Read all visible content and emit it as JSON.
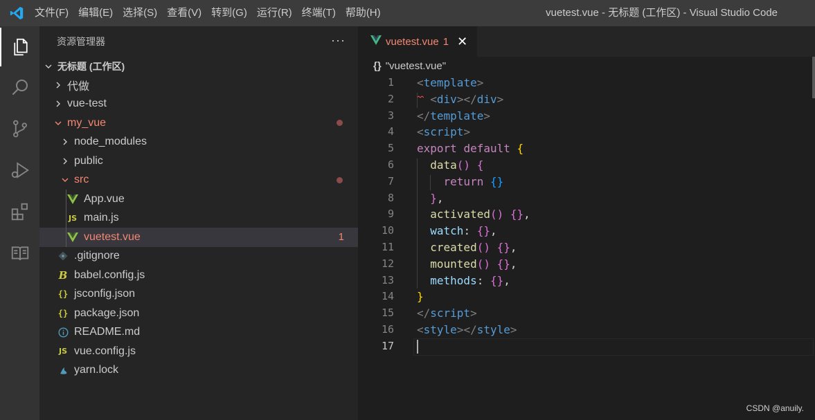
{
  "titlebar": {
    "menu": [
      "文件(F)",
      "编辑(E)",
      "选择(S)",
      "查看(V)",
      "转到(G)",
      "运行(R)",
      "终端(T)",
      "帮助(H)"
    ],
    "window_title": "vuetest.vue - 无标题 (工作区) - Visual Studio Code"
  },
  "activitybar": {
    "icons": [
      "explorer-icon",
      "search-icon",
      "source-control-icon",
      "run-debug-icon",
      "extensions-icon",
      "book-icon"
    ]
  },
  "sidebar": {
    "title": "资源管理器",
    "more": "···",
    "workspace": "无标题 (工作区)",
    "tree": [
      {
        "label": "代做",
        "indent": 1,
        "type": "folder",
        "open": false
      },
      {
        "label": "vue-test",
        "indent": 1,
        "type": "folder",
        "open": false
      },
      {
        "label": "my_vue",
        "indent": 1,
        "type": "folder",
        "open": true,
        "modified": true,
        "dot": true
      },
      {
        "label": "node_modules",
        "indent": 2,
        "type": "folder",
        "open": false
      },
      {
        "label": "public",
        "indent": 2,
        "type": "folder",
        "open": false
      },
      {
        "label": "src",
        "indent": 2,
        "type": "folder",
        "open": true,
        "modified": true,
        "dot": true
      },
      {
        "label": "App.vue",
        "indent": 3,
        "type": "vue"
      },
      {
        "label": "main.js",
        "indent": 3,
        "type": "js"
      },
      {
        "label": "vuetest.vue",
        "indent": 3,
        "type": "vue",
        "modified": true,
        "selected": true,
        "count": "1"
      },
      {
        "label": ".gitignore",
        "indent": 2,
        "type": "git"
      },
      {
        "label": "babel.config.js",
        "indent": 2,
        "type": "babel"
      },
      {
        "label": "jsconfig.json",
        "indent": 2,
        "type": "json"
      },
      {
        "label": "package.json",
        "indent": 2,
        "type": "json"
      },
      {
        "label": "README.md",
        "indent": 2,
        "type": "info"
      },
      {
        "label": "vue.config.js",
        "indent": 2,
        "type": "js"
      },
      {
        "label": "yarn.lock",
        "indent": 2,
        "type": "yarn"
      }
    ]
  },
  "editor": {
    "tab": {
      "label": "vuetest.vue",
      "count": "1",
      "close": "✕"
    },
    "breadcrumb": {
      "braces": "{}",
      "text": "\"vuetest.vue\""
    },
    "current_line": 17,
    "lines": [
      [
        [
          "<",
          "t-punc"
        ],
        [
          "template",
          "t-tag"
        ],
        [
          ">",
          "t-punc"
        ]
      ],
      [
        [
          "  ",
          "t-text"
        ],
        [
          "<",
          "t-punc"
        ],
        [
          "div",
          "t-tag"
        ],
        [
          "></",
          "t-punc"
        ],
        [
          "div",
          "t-tag"
        ],
        [
          ">",
          "t-punc"
        ]
      ],
      [
        [
          "</",
          "t-punc"
        ],
        [
          "template",
          "t-tag"
        ],
        [
          ">",
          "t-punc"
        ]
      ],
      [
        [
          "<",
          "t-punc"
        ],
        [
          "script",
          "t-tag"
        ],
        [
          ">",
          "t-punc"
        ]
      ],
      [
        [
          "export",
          "t-kw"
        ],
        [
          " ",
          "t-text"
        ],
        [
          "default",
          "t-kw"
        ],
        [
          " ",
          "t-text"
        ],
        [
          "{",
          "b1"
        ]
      ],
      [
        [
          "  ",
          "t-text"
        ],
        [
          "data",
          "t-fn"
        ],
        [
          "()",
          "b2"
        ],
        [
          " ",
          "t-text"
        ],
        [
          "{",
          "b2"
        ]
      ],
      [
        [
          "    ",
          "t-text"
        ],
        [
          "return",
          "t-kw"
        ],
        [
          " ",
          "t-text"
        ],
        [
          "{}",
          "b3"
        ]
      ],
      [
        [
          "  ",
          "t-text"
        ],
        [
          "}",
          "b2"
        ],
        [
          ",",
          "t-text"
        ]
      ],
      [
        [
          "  ",
          "t-text"
        ],
        [
          "activated",
          "t-fn"
        ],
        [
          "()",
          "b2"
        ],
        [
          " ",
          "t-text"
        ],
        [
          "{}",
          "b2"
        ],
        [
          ",",
          "t-text"
        ]
      ],
      [
        [
          "  ",
          "t-text"
        ],
        [
          "watch",
          "t-prop"
        ],
        [
          ": ",
          "t-text"
        ],
        [
          "{}",
          "b2"
        ],
        [
          ",",
          "t-text"
        ]
      ],
      [
        [
          "  ",
          "t-text"
        ],
        [
          "created",
          "t-fn"
        ],
        [
          "()",
          "b2"
        ],
        [
          " ",
          "t-text"
        ],
        [
          "{}",
          "b2"
        ],
        [
          ",",
          "t-text"
        ]
      ],
      [
        [
          "  ",
          "t-text"
        ],
        [
          "mounted",
          "t-fn"
        ],
        [
          "()",
          "b2"
        ],
        [
          " ",
          "t-text"
        ],
        [
          "{}",
          "b2"
        ],
        [
          ",",
          "t-text"
        ]
      ],
      [
        [
          "  ",
          "t-text"
        ],
        [
          "methods",
          "t-prop"
        ],
        [
          ": ",
          "t-text"
        ],
        [
          "{}",
          "b2"
        ],
        [
          ",",
          "t-text"
        ]
      ],
      [
        [
          "}",
          "b1"
        ]
      ],
      [
        [
          "</",
          "t-punc"
        ],
        [
          "script",
          "t-tag"
        ],
        [
          ">",
          "t-punc"
        ]
      ],
      [
        [
          "<",
          "t-punc"
        ],
        [
          "style",
          "t-tag"
        ],
        [
          "></",
          "t-punc"
        ],
        [
          "style",
          "t-tag"
        ],
        [
          ">",
          "t-punc"
        ]
      ],
      []
    ]
  },
  "watermark": "CSDN @anuily.",
  "colors": {
    "modified": "#f48771",
    "vue_icon": "#41b883",
    "json_icon": "#cbcb41",
    "js_icon": "#cbcb41",
    "info_icon": "#519aba"
  }
}
